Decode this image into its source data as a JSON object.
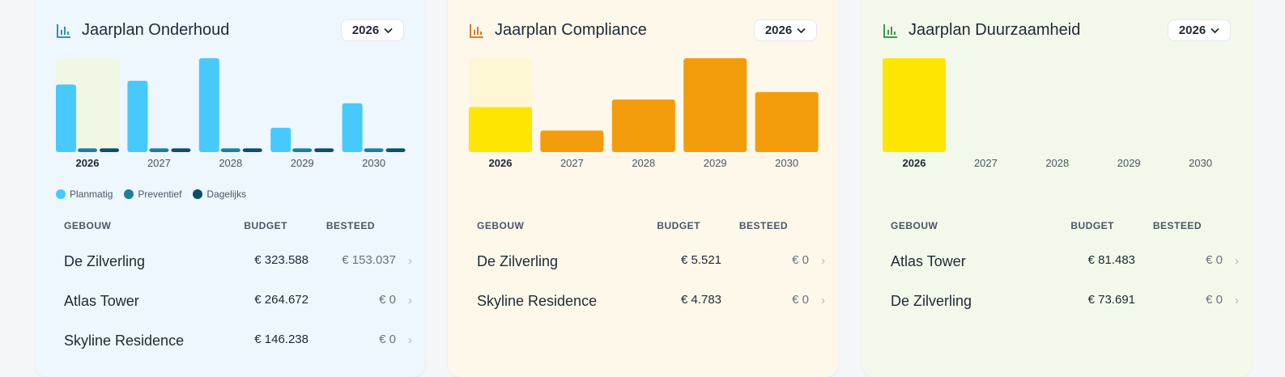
{
  "colors": {
    "planmatig": "#48c9fb",
    "preventief": "#1f7f9c",
    "dagelijks": "#104f63",
    "compliance_bar": "#f39c0b",
    "selected_yellow": "#ffe500"
  },
  "cards": [
    {
      "title": "Jaarplan Onderhoud",
      "icon": "bar-chart-icon",
      "year": "2026",
      "legend": [
        "Planmatig",
        "Preventief",
        "Dagelijks"
      ],
      "columns": {
        "gebouw": "GEBOUW",
        "budget": "BUDGET",
        "besteed": "BESTEED"
      },
      "rows": [
        {
          "name": "De Zilverling",
          "budget": "€ 323.588",
          "besteed": "€ 153.037"
        },
        {
          "name": "Atlas Tower",
          "budget": "€ 264.672",
          "besteed": "€ 0"
        },
        {
          "name": "Skyline Residence",
          "budget": "€ 146.238",
          "besteed": "€ 0"
        }
      ]
    },
    {
      "title": "Jaarplan Compliance",
      "icon": "bar-chart-icon",
      "year": "2026",
      "columns": {
        "gebouw": "GEBOUW",
        "budget": "BUDGET",
        "besteed": "BESTEED"
      },
      "rows": [
        {
          "name": "De Zilverling",
          "budget": "€ 5.521",
          "besteed": "€ 0"
        },
        {
          "name": "Skyline Residence",
          "budget": "€ 4.783",
          "besteed": "€ 0"
        }
      ]
    },
    {
      "title": "Jaarplan Duurzaamheid",
      "icon": "bar-chart-icon",
      "year": "2026",
      "columns": {
        "gebouw": "GEBOUW",
        "budget": "BUDGET",
        "besteed": "BESTEED"
      },
      "rows": [
        {
          "name": "Atlas Tower",
          "budget": "€ 81.483",
          "besteed": "€ 0"
        },
        {
          "name": "De Zilverling",
          "budget": "€ 73.691",
          "besteed": "€ 0"
        }
      ]
    }
  ],
  "chart_data": [
    {
      "type": "bar",
      "categories": [
        "2026",
        "2027",
        "2028",
        "2029",
        "2030"
      ],
      "selected": "2026",
      "ylim": [
        0,
        1
      ],
      "series": [
        {
          "name": "Planmatig",
          "values": [
            0.72,
            0.76,
            1.0,
            0.26,
            0.52
          ]
        },
        {
          "name": "Preventief",
          "values": [
            0.04,
            0.04,
            0.04,
            0.04,
            0.04
          ]
        },
        {
          "name": "Dagelijks",
          "values": [
            0.04,
            0.04,
            0.04,
            0.04,
            0.04
          ]
        }
      ]
    },
    {
      "type": "bar",
      "categories": [
        "2026",
        "2027",
        "2028",
        "2029",
        "2030"
      ],
      "selected": "2026",
      "ylim": [
        0,
        1
      ],
      "series": [
        {
          "values": [
            0.48,
            0.23,
            0.56,
            1.0,
            0.64
          ]
        }
      ]
    },
    {
      "type": "bar",
      "categories": [
        "2026",
        "2027",
        "2028",
        "2029",
        "2030"
      ],
      "selected": "2026",
      "ylim": [
        0,
        1
      ],
      "series": [
        {
          "values": [
            1.0,
            0,
            0,
            0,
            0
          ]
        }
      ]
    }
  ]
}
